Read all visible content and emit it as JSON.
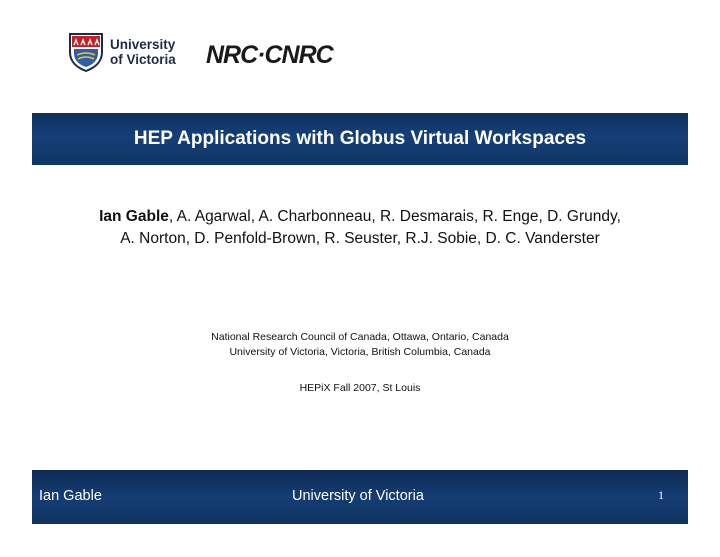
{
  "header": {
    "uvic_logo": {
      "line1": "University",
      "line2": "of Victoria",
      "icon": "uvic-shield-icon"
    },
    "nrc_logo": {
      "text": "NRC·CNRC",
      "icon": "nrc-cnrc-logo"
    }
  },
  "title": "HEP Applications with Globus Virtual Workspaces",
  "authors": {
    "lead": "Ian Gable",
    "line1_rest": ", A. Agarwal, A. Charbonneau, R. Desmarais, R. Enge, D. Grundy,",
    "line2": "A. Norton, D. Penfold-Brown, R. Seuster, R.J. Sobie, D. C. Vanderster"
  },
  "affiliations": [
    "National Research Council of Canada, Ottawa, Ontario, Canada",
    "University of Victoria, Victoria, British Columbia, Canada"
  ],
  "event": "HEPiX Fall 2007, St Louis",
  "footer": {
    "left": "Ian Gable",
    "center": "University of Victoria",
    "page": "1"
  },
  "colors": {
    "band": "#163f78",
    "band_text": "#ffffff",
    "uvic_red": "#c62026",
    "uvic_blue": "#1f2a44"
  }
}
